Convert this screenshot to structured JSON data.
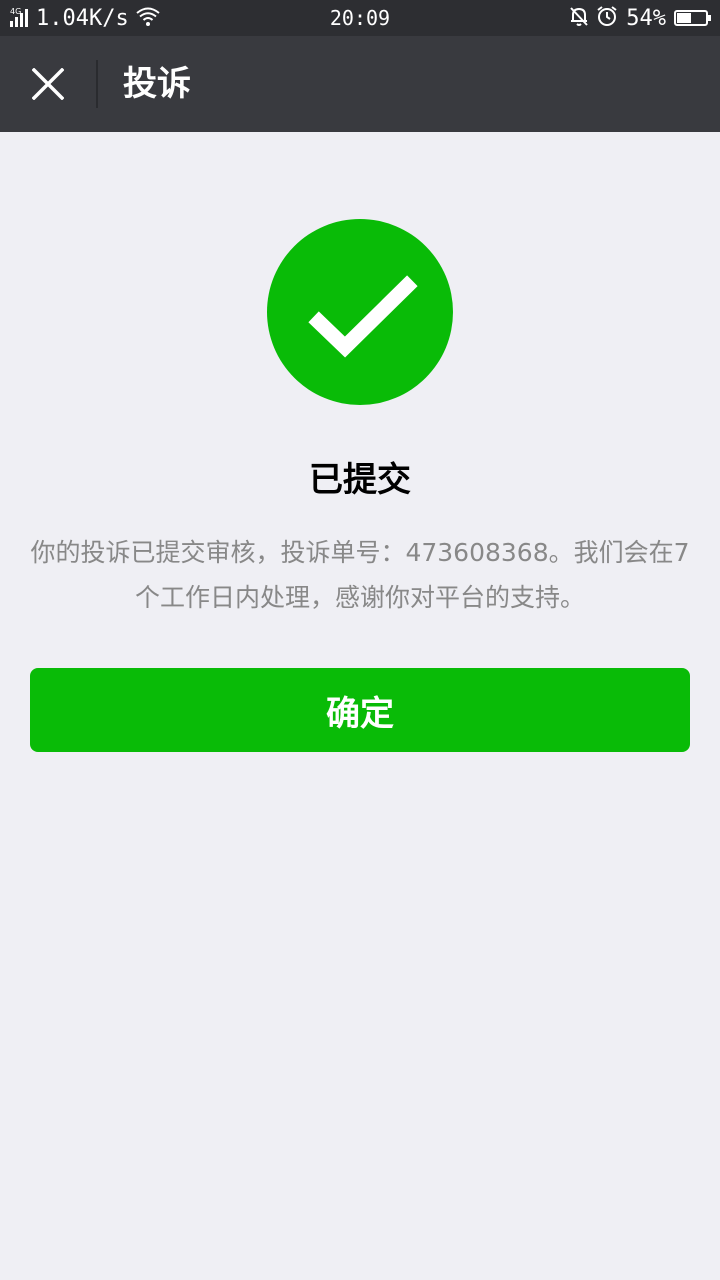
{
  "status_bar": {
    "network_type": "4G",
    "speed": "1.04K/s",
    "time": "20:09",
    "battery_percent": "54%",
    "battery_level": 0.54,
    "icons": [
      "signal-icon",
      "wifi-icon",
      "bell-muted-icon",
      "alarm-icon",
      "battery-icon"
    ]
  },
  "nav": {
    "title": "投诉",
    "close_icon": "close-icon"
  },
  "result": {
    "icon": "success-check-icon",
    "title": "已提交",
    "description": "你的投诉已提交审核，投诉单号：473608368。我们会在7个工作日内处理，感谢你对平台的支持。"
  },
  "actions": {
    "confirm_label": "确定"
  },
  "colors": {
    "status_bar_bg": "#2d2e32",
    "nav_bg": "#393a3f",
    "page_bg": "#efeff4",
    "primary_green": "#09bb07",
    "desc_text": "#888888"
  }
}
